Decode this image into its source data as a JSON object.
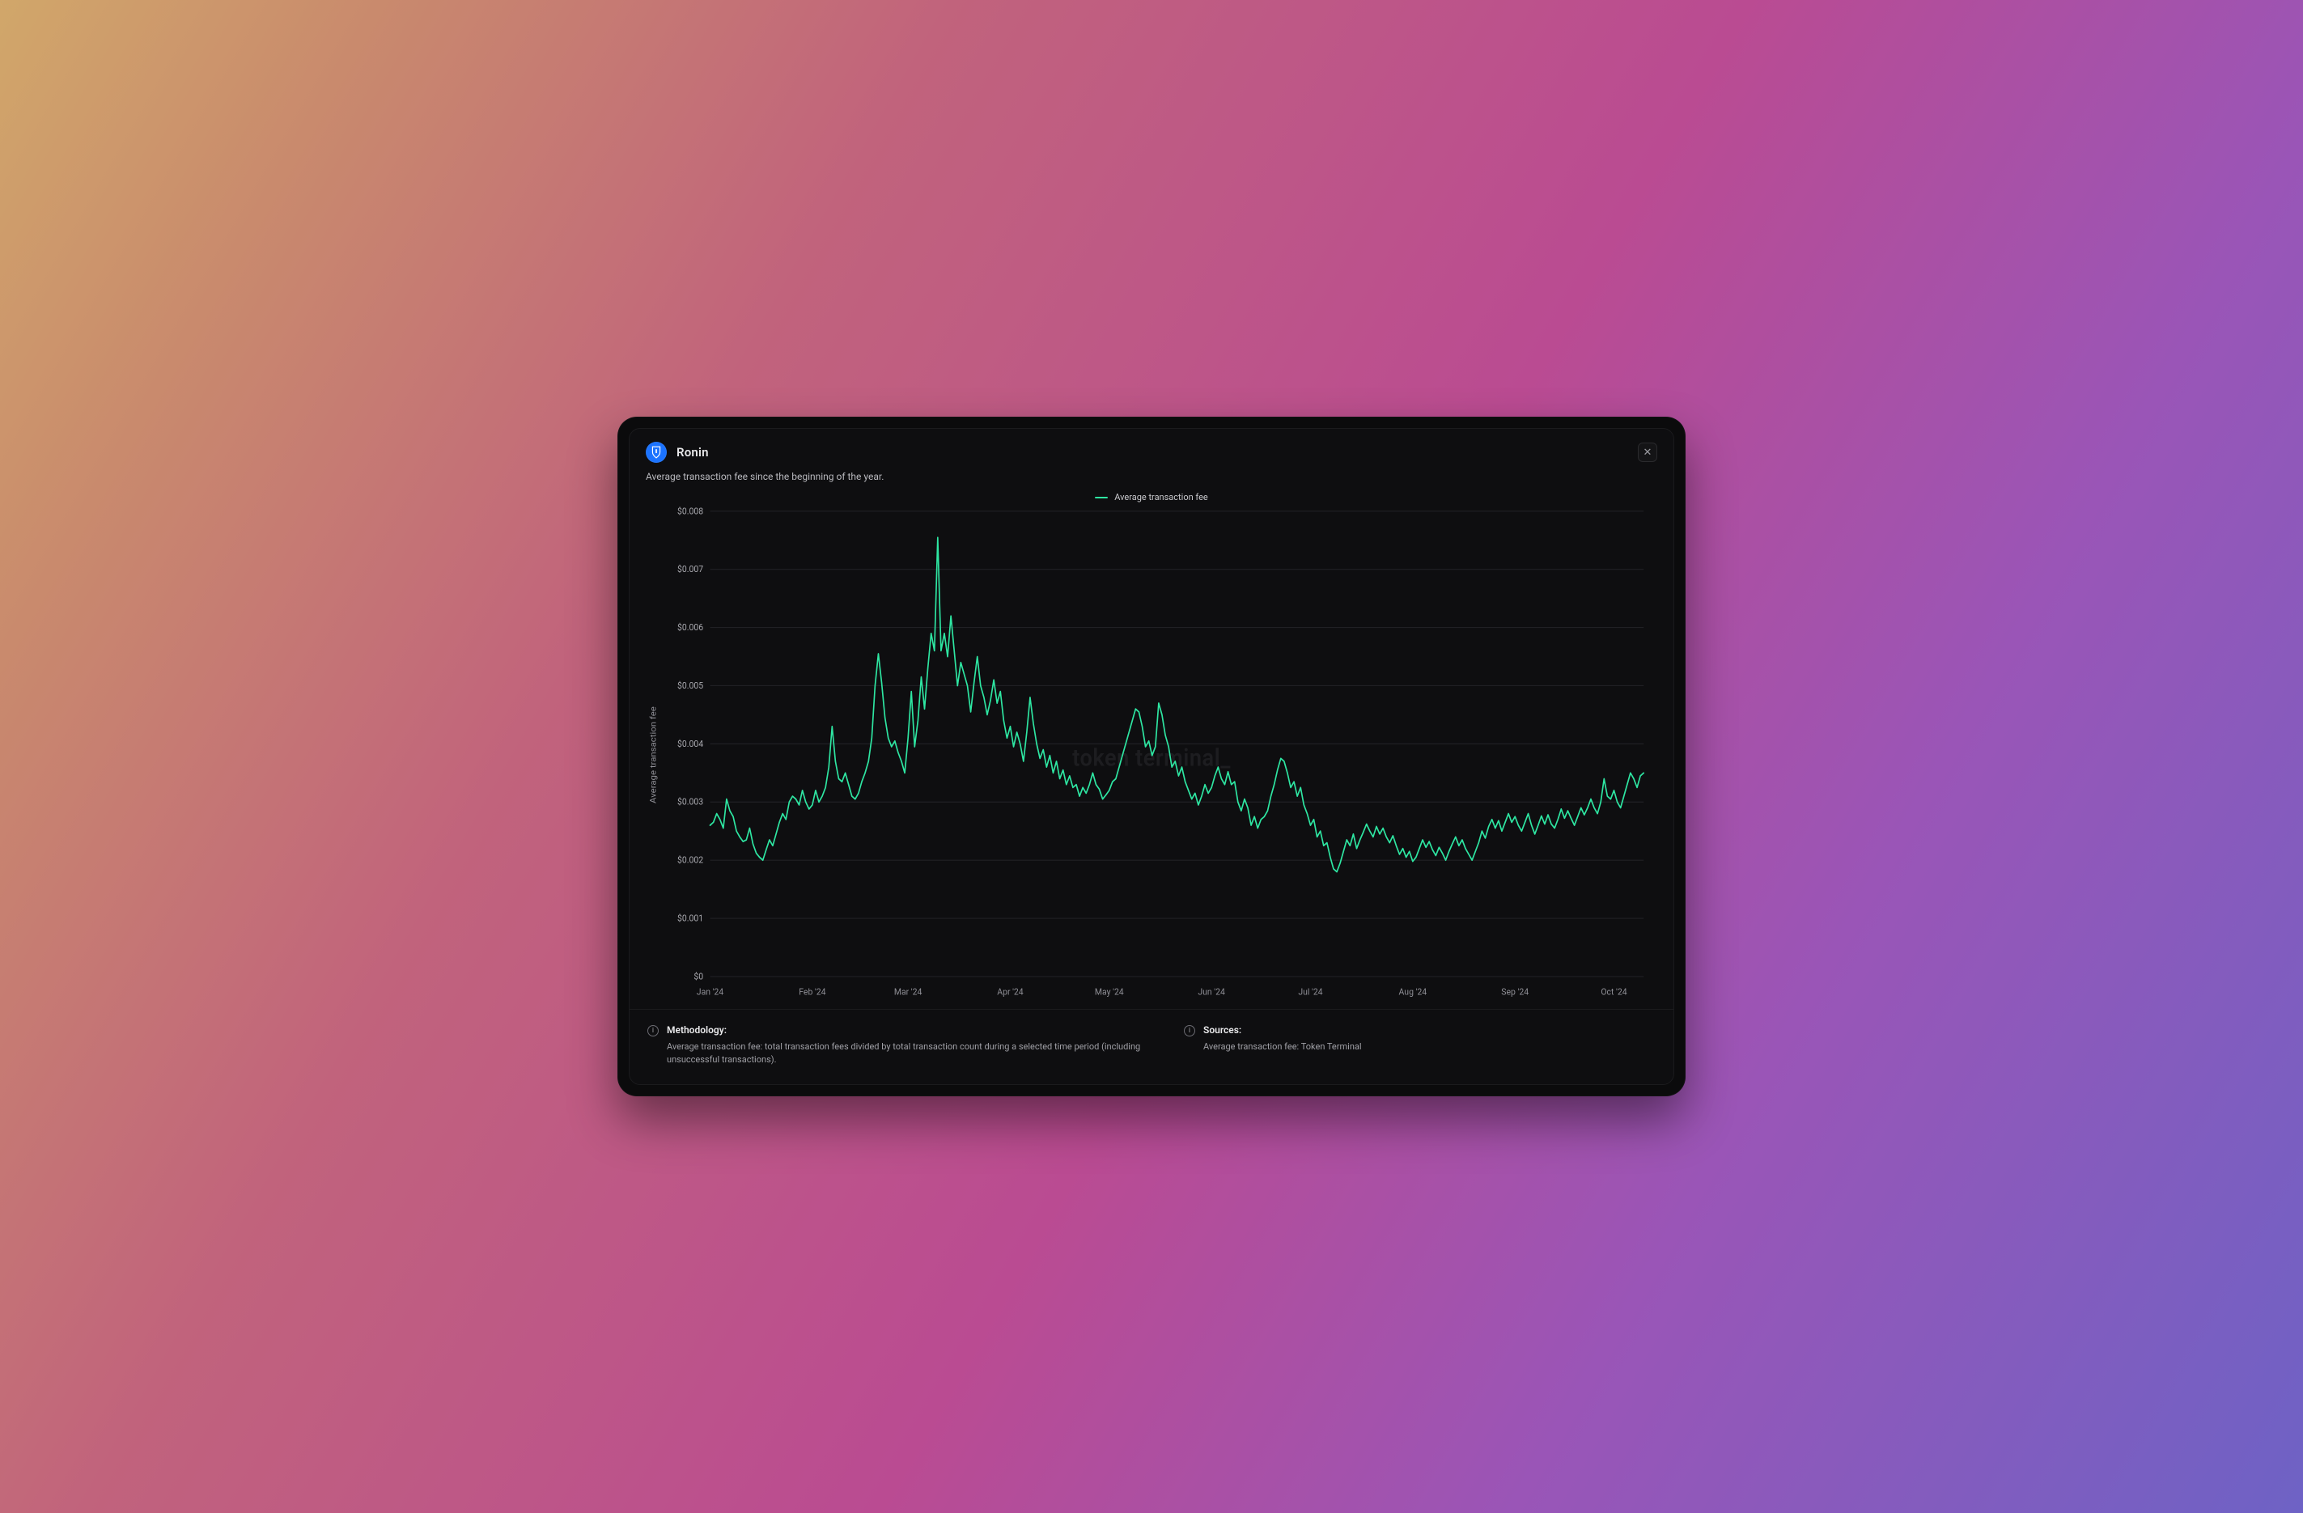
{
  "header": {
    "title": "Ronin",
    "logo_name": "ronin-shield-icon"
  },
  "subtitle": "Average transaction fee since the beginning of the year.",
  "legend": {
    "series_label": "Average transaction fee",
    "series_color": "#2ee6a2"
  },
  "watermark": "token terminal_",
  "footer": {
    "methodology_heading": "Methodology:",
    "methodology_body": "Average transaction fee: total transaction fees divided by total transaction count during a selected time period (including unsuccessful transactions).",
    "sources_heading": "Sources:",
    "sources_body": "Average transaction fee: Token Terminal"
  },
  "chart_data": {
    "type": "line",
    "title": "",
    "xlabel": "",
    "ylabel": "Average transaction fee",
    "ylim": [
      0,
      0.008
    ],
    "y_ticks": [
      0,
      0.001,
      0.002,
      0.003,
      0.004,
      0.005,
      0.006,
      0.007,
      0.008
    ],
    "y_tick_labels": [
      "$0",
      "$0.001",
      "$0.002",
      "$0.003",
      "$0.004",
      "$0.005",
      "$0.006",
      "$0.007",
      "$0.008"
    ],
    "x_tick_indices": [
      0,
      31,
      60,
      91,
      121,
      152,
      182,
      213,
      244,
      274
    ],
    "x_tick_labels": [
      "Jan '24",
      "Feb '24",
      "Mar '24",
      "Apr '24",
      "May '24",
      "Jun '24",
      "Jul '24",
      "Aug '24",
      "Sep '24",
      "Oct '24"
    ],
    "series": [
      {
        "name": "Average transaction fee",
        "color": "#2ee6a2",
        "values": [
          0.0026,
          0.00265,
          0.0028,
          0.0027,
          0.00255,
          0.00305,
          0.00285,
          0.00275,
          0.0025,
          0.0024,
          0.00232,
          0.00235,
          0.00255,
          0.00228,
          0.00212,
          0.00205,
          0.002,
          0.00218,
          0.00235,
          0.00225,
          0.00245,
          0.00265,
          0.0028,
          0.0027,
          0.003,
          0.0031,
          0.00305,
          0.00295,
          0.0032,
          0.003,
          0.00288,
          0.00295,
          0.0032,
          0.003,
          0.0031,
          0.00325,
          0.0036,
          0.0043,
          0.0037,
          0.0034,
          0.00335,
          0.0035,
          0.0033,
          0.0031,
          0.00305,
          0.00315,
          0.00335,
          0.0035,
          0.0037,
          0.0041,
          0.005,
          0.00555,
          0.00505,
          0.00445,
          0.0041,
          0.00395,
          0.00405,
          0.00385,
          0.0037,
          0.0035,
          0.0041,
          0.0049,
          0.00395,
          0.0044,
          0.00515,
          0.0046,
          0.0053,
          0.0059,
          0.0056,
          0.00755,
          0.0056,
          0.0059,
          0.0055,
          0.0062,
          0.0056,
          0.005,
          0.0054,
          0.0052,
          0.005,
          0.00455,
          0.00505,
          0.0055,
          0.005,
          0.0048,
          0.0045,
          0.00475,
          0.0051,
          0.0047,
          0.0049,
          0.0044,
          0.0041,
          0.0043,
          0.00395,
          0.0042,
          0.004,
          0.0037,
          0.0042,
          0.0048,
          0.00435,
          0.004,
          0.00375,
          0.0039,
          0.0036,
          0.0038,
          0.0035,
          0.0037,
          0.0034,
          0.00355,
          0.0033,
          0.00345,
          0.00325,
          0.0033,
          0.0031,
          0.00325,
          0.00315,
          0.0033,
          0.0035,
          0.0033,
          0.00322,
          0.00305,
          0.00312,
          0.0032,
          0.00335,
          0.0034,
          0.0036,
          0.0038,
          0.004,
          0.0042,
          0.0044,
          0.0046,
          0.00455,
          0.0043,
          0.00395,
          0.00405,
          0.0038,
          0.00395,
          0.0047,
          0.0045,
          0.00415,
          0.00395,
          0.0036,
          0.0037,
          0.00345,
          0.0036,
          0.00335,
          0.0032,
          0.00305,
          0.00315,
          0.00295,
          0.0031,
          0.0033,
          0.00315,
          0.00325,
          0.00345,
          0.0036,
          0.0034,
          0.0033,
          0.00352,
          0.0033,
          0.00335,
          0.003,
          0.00285,
          0.00305,
          0.0029,
          0.0026,
          0.00275,
          0.00255,
          0.0027,
          0.00275,
          0.00285,
          0.0031,
          0.0033,
          0.00355,
          0.00375,
          0.0037,
          0.0035,
          0.00325,
          0.00335,
          0.0031,
          0.00325,
          0.00295,
          0.0028,
          0.0026,
          0.0027,
          0.0024,
          0.0025,
          0.00225,
          0.0023,
          0.00205,
          0.00185,
          0.0018,
          0.00195,
          0.00215,
          0.00235,
          0.00225,
          0.00245,
          0.0022,
          0.00235,
          0.00248,
          0.00262,
          0.0025,
          0.0024,
          0.00258,
          0.00245,
          0.00255,
          0.0024,
          0.0023,
          0.00242,
          0.00225,
          0.0021,
          0.0022,
          0.00205,
          0.00215,
          0.00198,
          0.00205,
          0.0022,
          0.00235,
          0.00222,
          0.00232,
          0.00218,
          0.00208,
          0.00222,
          0.00212,
          0.002,
          0.00215,
          0.00228,
          0.0024,
          0.00225,
          0.00235,
          0.0022,
          0.0021,
          0.002,
          0.00215,
          0.0023,
          0.0025,
          0.00238,
          0.00258,
          0.0027,
          0.00255,
          0.00268,
          0.0025,
          0.00265,
          0.0028,
          0.00265,
          0.00275,
          0.0026,
          0.0025,
          0.00265,
          0.0028,
          0.0026,
          0.00245,
          0.0026,
          0.00276,
          0.00262,
          0.00278,
          0.00262,
          0.00255,
          0.0027,
          0.00288,
          0.00272,
          0.00285,
          0.00272,
          0.0026,
          0.00275,
          0.0029,
          0.00278,
          0.0029,
          0.00305,
          0.0029,
          0.0028,
          0.003,
          0.0034,
          0.0031,
          0.00305,
          0.0032,
          0.003,
          0.0029,
          0.0031,
          0.0033,
          0.0035,
          0.0034,
          0.00325,
          0.00345,
          0.0035
        ]
      }
    ]
  }
}
